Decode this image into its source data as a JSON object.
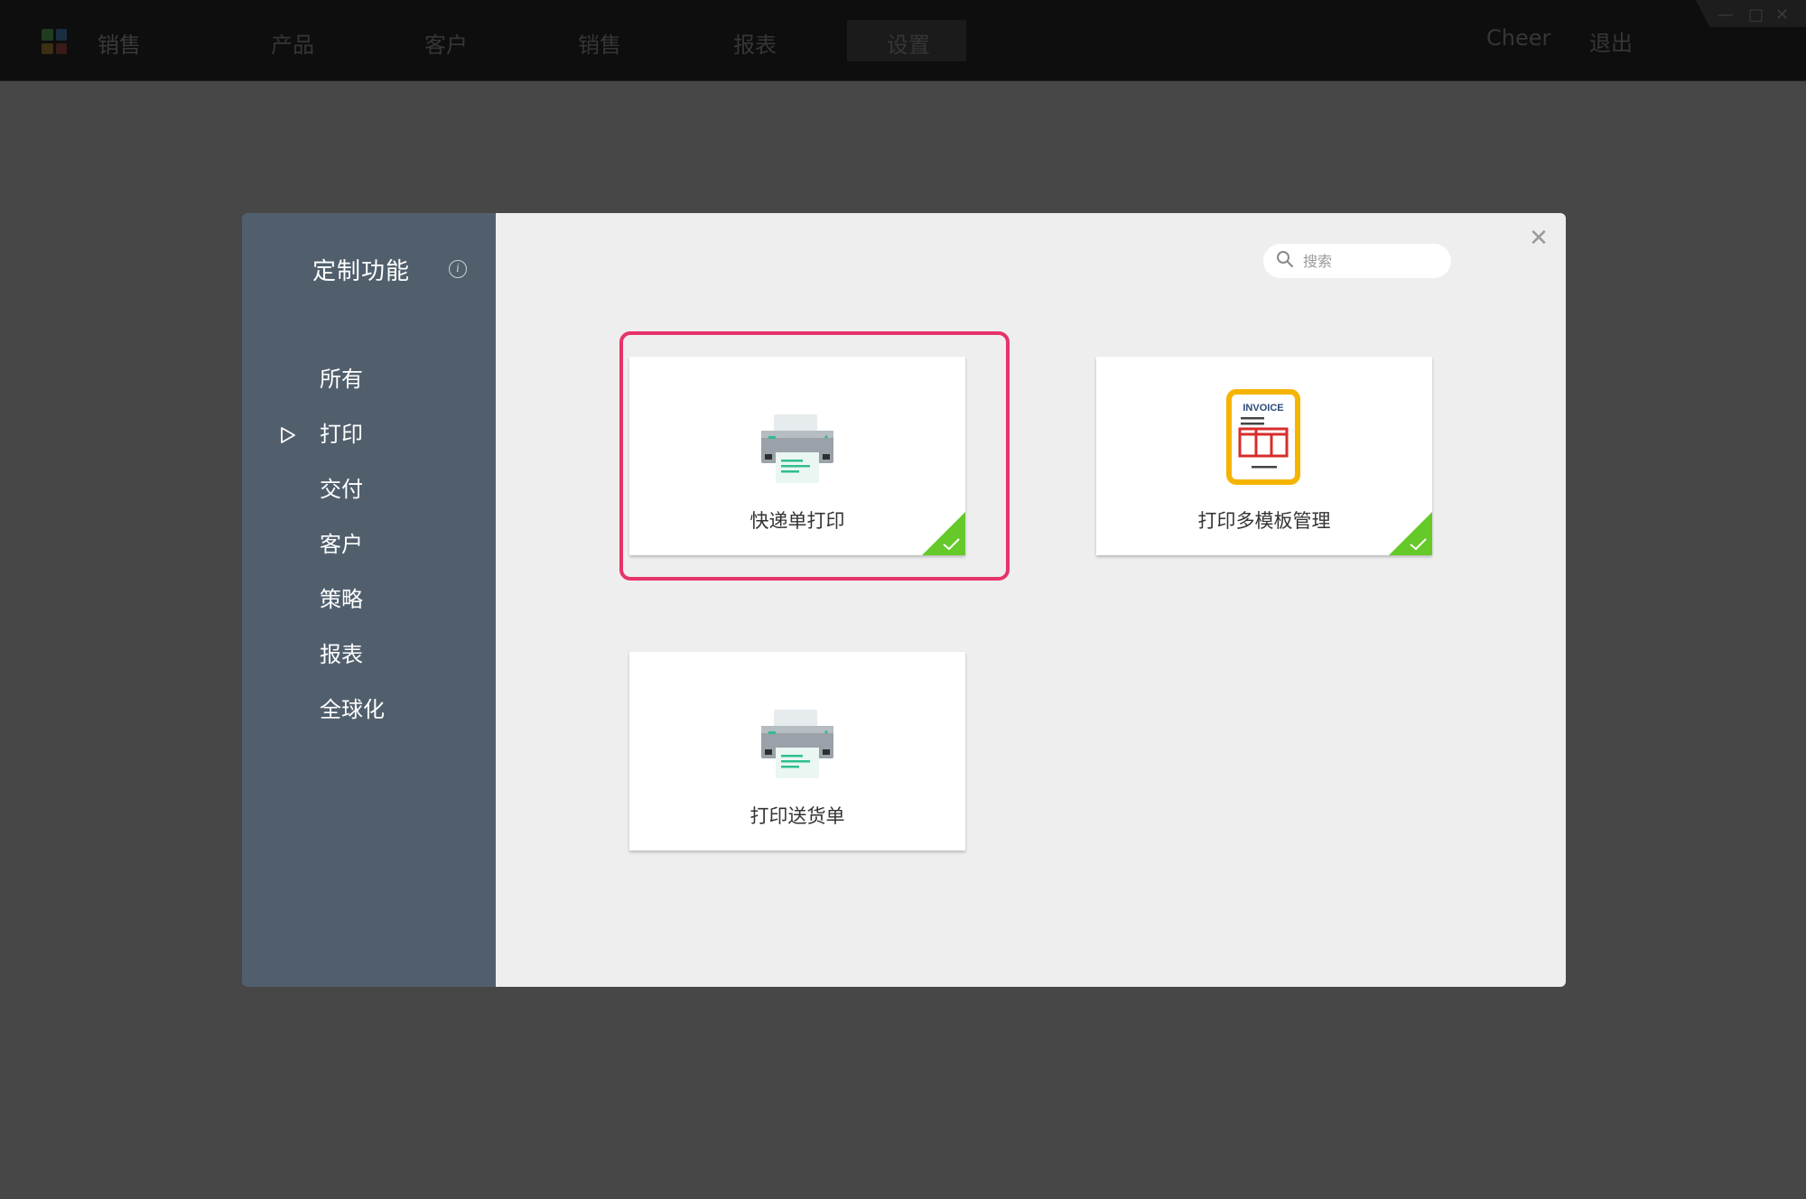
{
  "topbar": {
    "app_name": "销售",
    "nav": [
      "产品",
      "客户",
      "销售",
      "报表",
      "设置"
    ],
    "active_nav": "设置",
    "user": "Cheer",
    "logout": "退出"
  },
  "modal": {
    "title": "定制功能",
    "info_icon": "info-icon",
    "close_icon": "close-icon",
    "search": {
      "placeholder": "搜索",
      "value": ""
    },
    "categories": [
      {
        "label": "所有",
        "selected": false
      },
      {
        "label": "打印",
        "selected": true
      },
      {
        "label": "交付",
        "selected": false
      },
      {
        "label": "客户",
        "selected": false
      },
      {
        "label": "策略",
        "selected": false
      },
      {
        "label": "报表",
        "selected": false
      },
      {
        "label": "全球化",
        "selected": false
      }
    ],
    "cards": [
      {
        "label": "快递单打印",
        "icon": "printer-icon",
        "installed": true,
        "highlighted": true
      },
      {
        "label": "打印多模板管理",
        "icon": "invoice-icon",
        "icon_text": "INVOICE",
        "installed": true,
        "highlighted": false
      },
      {
        "label": "打印送货单",
        "icon": "printer-icon",
        "installed": false,
        "highlighted": false
      }
    ]
  },
  "colors": {
    "sidebar": "#515f6d",
    "content_bg": "#eeeeee",
    "highlight": "#e6336a",
    "installed_badge": "#66c92a",
    "printer_accent": "#2ebf8e",
    "invoice_frame": "#f4b400",
    "invoice_grid": "#d82c2c"
  }
}
